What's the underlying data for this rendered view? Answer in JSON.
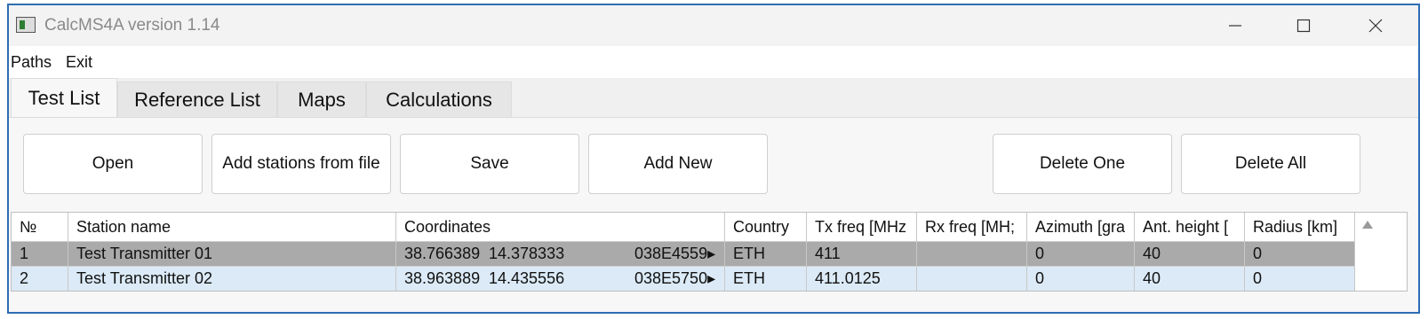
{
  "window": {
    "title": "CalcMS4A version 1.14"
  },
  "menu": {
    "paths": "Paths",
    "exit": "Exit"
  },
  "tabs": [
    "Test List",
    "Reference List",
    "Maps",
    "Calculations"
  ],
  "active_tab": "Test List",
  "toolbar": {
    "open": "Open",
    "add_stations": "Add stations from file",
    "save": "Save",
    "add_new": "Add New",
    "delete_one": "Delete One",
    "delete_all": "Delete All"
  },
  "table": {
    "columns": [
      "№",
      "Station name",
      "Coordinates",
      "Country",
      "Tx freq [MHz",
      "Rx freq [MH;",
      "Azimuth [gra",
      "Ant. height [",
      "Radius [km]"
    ],
    "rows": [
      {
        "no": "1",
        "name": "Test Transmitter 01",
        "lat": "38.766389",
        "lon": "14.378333",
        "code": "038E4559▸",
        "country": "ETH",
        "tx": "411",
        "rx": "",
        "azimuth": "0",
        "ant_height": "40",
        "radius": "0",
        "state": "selected"
      },
      {
        "no": "2",
        "name": "Test Transmitter 02",
        "lat": "38.963889",
        "lon": "14.435556",
        "code": "038E5750▸",
        "country": "ETH",
        "tx": "411.0125",
        "rx": "",
        "azimuth": "0",
        "ant_height": "40",
        "radius": "0",
        "state": "normal"
      }
    ]
  },
  "colors": {
    "window_border": "#2e6db4",
    "selected_row": "#aaaaaa",
    "alt_row": "#dbeaf6"
  },
  "icons": {
    "app": "app-window-icon",
    "minimize": "minimize-icon",
    "maximize": "maximize-icon",
    "close": "close-icon",
    "scroll_up": "scroll-up-arrow-icon"
  }
}
